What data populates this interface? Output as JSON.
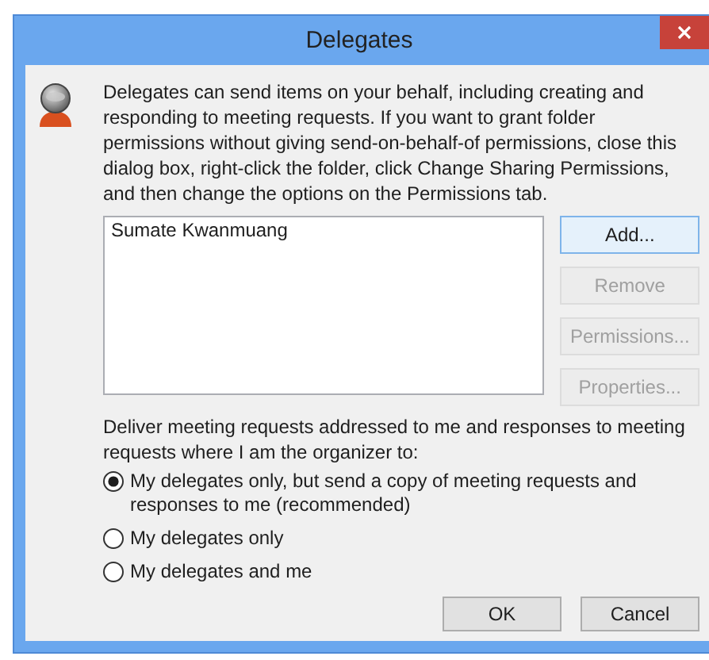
{
  "window": {
    "title": "Delegates"
  },
  "description": "Delegates can send items on your behalf, including creating and responding to meeting requests. If you want to grant folder permissions without giving send-on-behalf-of permissions, close this dialog box, right-click the folder, click Change Sharing Permissions, and then change the options on the Permissions tab.",
  "delegates": [
    {
      "name": "Sumate Kwanmuang",
      "selected": false
    }
  ],
  "side_buttons": [
    {
      "label": "Add...",
      "disabled": false
    },
    {
      "label": "Remove",
      "disabled": true
    },
    {
      "label": "Permissions...",
      "disabled": true
    },
    {
      "label": "Properties...",
      "disabled": true
    }
  ],
  "delivery_label": "Deliver meeting requests addressed to me and responses to meeting requests where I am the organizer to:",
  "delivery_options": [
    {
      "label": "My delegates only, but send a copy of meeting requests and responses to me (recommended)",
      "selected": true
    },
    {
      "label": "My delegates only",
      "selected": false
    },
    {
      "label": "My delegates and me",
      "selected": false
    }
  ],
  "footer_buttons": [
    {
      "label": "OK",
      "disabled": false
    },
    {
      "label": "Cancel",
      "disabled": false
    }
  ]
}
